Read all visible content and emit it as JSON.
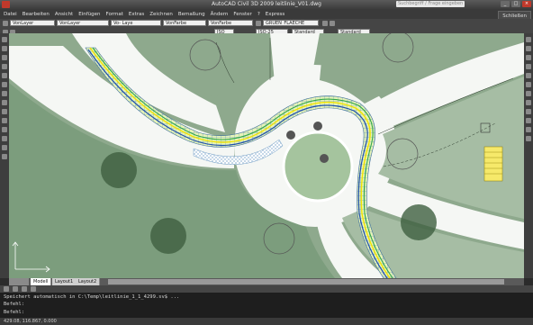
{
  "window": {
    "title": "AutoCAD Civil 3D 2009  leitlinie_V01.dwg",
    "search_placeholder": "Suchbegriff / Frage eingeben",
    "minimize": "_",
    "maximize": "□",
    "close": "×"
  },
  "menu": {
    "items": [
      "Datei",
      "Bearbeiten",
      "Ansicht",
      "Einfügen",
      "Format",
      "Extras",
      "Zeichnen",
      "Bemaßung",
      "Ändern",
      "Fenster",
      "?",
      "Express"
    ],
    "right_button": "Schließen"
  },
  "toolbar1": {
    "layer_combo": "VonLayer",
    "linetype_combo": "VonLayer",
    "lineweight_combo": "Vo- Laye",
    "color_combo": "VonFarbe",
    "plotstyle_combo": "VonFarbe",
    "layer_name_combo": "GRUEN_FLAECHE"
  },
  "toolbar2": {
    "scale_combo": "ISO-25",
    "style_combo": "Standard",
    "table_combo": "Standard",
    "iso_label": "ISO"
  },
  "layout_tabs": [
    "Modell",
    "Layout1",
    "Layout2"
  ],
  "command_line": {
    "line1": "Speichert automatisch in C:\\Temp\\leitlinie_1_1_4299.sv$ ...",
    "line2": "Befehl:",
    "line3": "Befehl:"
  },
  "status": {
    "coordinates": "429.08, 116.867, 0.000"
  },
  "colors": {
    "lawn": "#8ea98d",
    "lawn_dark": "#7a9a7c",
    "road": "#f5f7f4",
    "hatch_fill": "#e6f3b8",
    "hatch_line": "#4c86b8",
    "lane_yellow": "#f3e400",
    "lane_green": "#33a84a",
    "lane_blue": "#1f4fb0",
    "parking_yellow": "#f6e96a"
  }
}
